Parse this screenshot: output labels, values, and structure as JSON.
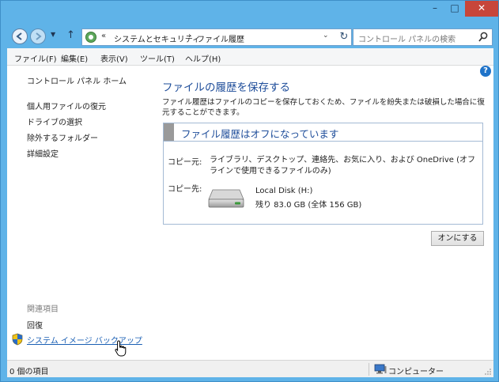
{
  "window": {
    "caption": {
      "minimize": "–",
      "maximize": "□",
      "close": "✕"
    }
  },
  "nav": {
    "back_icon": "back-arrow-icon",
    "forward_icon": "forward-arrow-icon",
    "up_icon": "up-arrow-icon",
    "address": {
      "prefix": "«",
      "segment1": "システムとセキュリティ",
      "separator": "›",
      "segment2": "ファイル履歴"
    },
    "search_placeholder": "コントロール パネルの検索"
  },
  "menu": {
    "items": [
      "ファイル(F)",
      "編集(E)",
      "表示(V)",
      "ツール(T)",
      "ヘルプ(H)"
    ]
  },
  "sidebar": {
    "home": "コントロール パネル ホーム",
    "links": [
      "個人用ファイルの復元",
      "ドライブの選択",
      "除外するフォルダー",
      "詳細設定"
    ],
    "related_header": "関連項目",
    "related_links": [
      "回復",
      "システム イメージ バックアップ"
    ]
  },
  "main": {
    "help": "?",
    "title": "ファイルの履歴を保存する",
    "description": "ファイル履歴はファイルのコピーを保存しておくため、ファイルを紛失または破損した場合に復元することができます。",
    "status_title": "ファイル履歴はオフになっています",
    "copy_source_label": "コピー元:",
    "copy_source_value": "ライブラリ、デスクトップ、連絡先、お気に入り、および OneDrive (オフラインで使用できるファイルのみ)",
    "copy_dest_label": "コピー先:",
    "disk_name": "Local Disk (H:)",
    "disk_free": "残り 83.0 GB (全体 156 GB)",
    "turn_on_button": "オンにする"
  },
  "status": {
    "item_count": "0 個の項目",
    "location": "コンピューター"
  },
  "colors": {
    "frame": "#5fb3e8",
    "title_blue": "#1e4d9a",
    "link_blue": "#1a5fb4",
    "close_red": "#c7463a"
  }
}
